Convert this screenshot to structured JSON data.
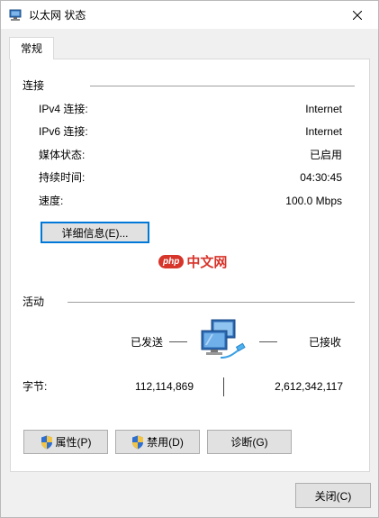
{
  "window": {
    "title": "以太网 状态",
    "close_glyph": "✕"
  },
  "tabs": [
    {
      "label": "常规"
    }
  ],
  "connection": {
    "section_title": "连接",
    "rows": [
      {
        "label": "IPv4 连接:",
        "value": "Internet"
      },
      {
        "label": "IPv6 连接:",
        "value": "Internet"
      },
      {
        "label": "媒体状态:",
        "value": "已启用"
      },
      {
        "label": "持续时间:",
        "value": "04:30:45"
      },
      {
        "label": "速度:",
        "value": "100.0 Mbps"
      }
    ],
    "details_button": "详细信息(E)..."
  },
  "watermark": {
    "badge": "php",
    "text": "中文网"
  },
  "activity": {
    "section_title": "活动",
    "sent_label": "已发送",
    "received_label": "已接收",
    "bytes_label": "字节:",
    "bytes_sent": "112,114,869",
    "bytes_received": "2,612,342,117"
  },
  "buttons": {
    "properties": "属性(P)",
    "disable": "禁用(D)",
    "diagnose": "诊断(G)",
    "close": "关闭(C)"
  },
  "icons": {
    "title": "network-adapter-icon",
    "activity": "network-computers-icon",
    "admin": "uac-shield-icon"
  },
  "colors": {
    "accent": "#0078d7",
    "watermark_red": "#d7342a",
    "window_bg": "#f0f0f0",
    "panel_bg": "#ffffff"
  }
}
